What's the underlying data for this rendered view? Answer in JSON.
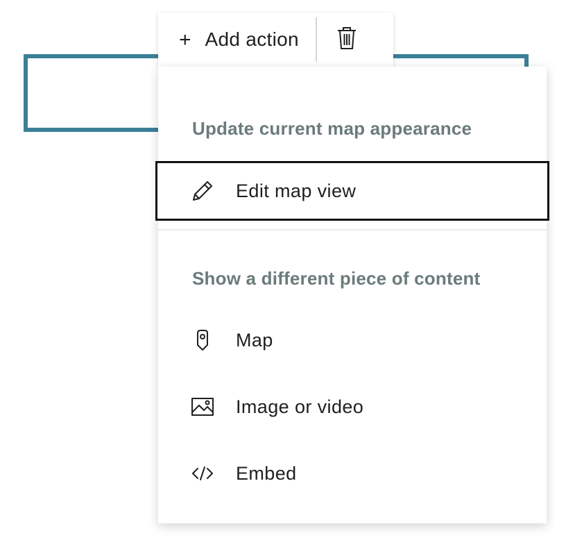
{
  "toolbar": {
    "add_action_icon": "+",
    "add_action_label": "Add action",
    "delete_icon": "trash-icon"
  },
  "menu": {
    "sections": [
      {
        "heading": "Update current map appearance",
        "items": [
          {
            "label": "Edit map view",
            "icon": "pencil-icon",
            "focused": true
          }
        ]
      },
      {
        "heading": "Show a different piece of content",
        "items": [
          {
            "label": "Map",
            "icon": "map-pin-icon"
          },
          {
            "label": "Image or video",
            "icon": "image-icon"
          },
          {
            "label": "Embed",
            "icon": "code-icon"
          }
        ]
      }
    ]
  },
  "colors": {
    "selection_outline": "#3c7f96",
    "heading_text": "#6b7b7b",
    "focus_border": "#111111"
  }
}
